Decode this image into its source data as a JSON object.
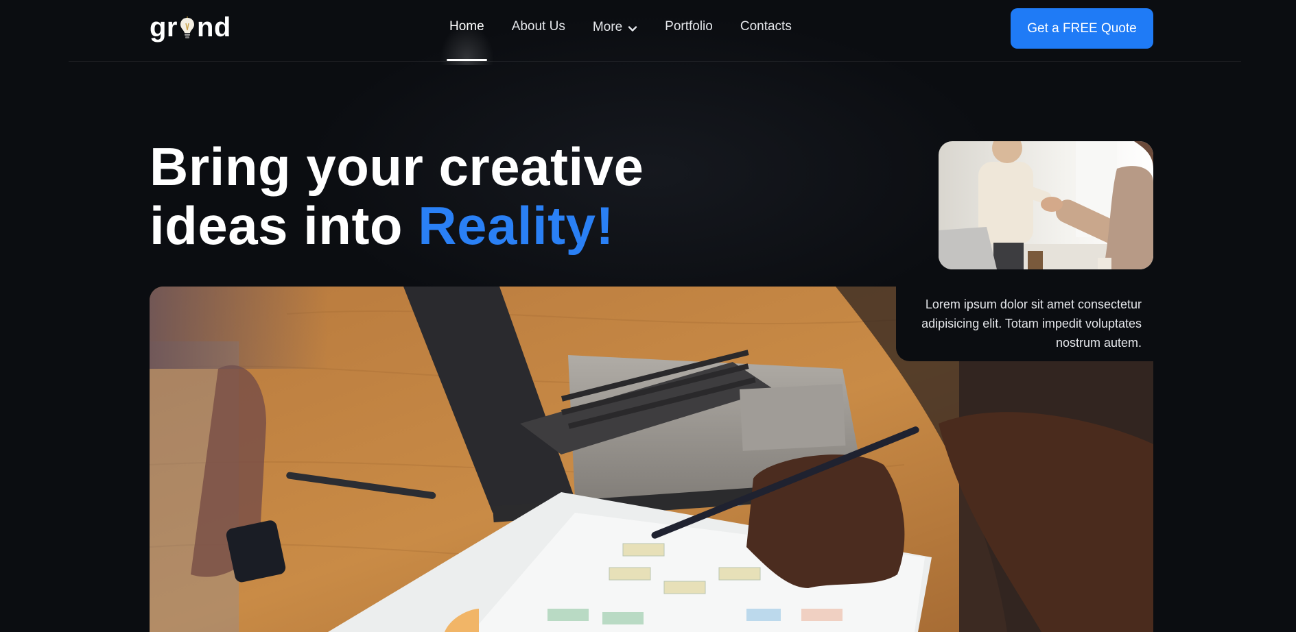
{
  "nav": {
    "logo": {
      "before": "gr",
      "after": "nd"
    },
    "items": [
      {
        "label": "Home"
      },
      {
        "label": "About Us"
      },
      {
        "label": "More"
      },
      {
        "label": "Portfolio"
      },
      {
        "label": "Contacts"
      }
    ],
    "active_item": "Home",
    "cta_label": "Get a FREE Quote"
  },
  "hero": {
    "headline_line1": "Bring your creative",
    "headline_line2_plain": "ideas into ",
    "headline_accent": "Reality!",
    "description": "Lorem ipsum dolor sit amet consectetur adipisicing elit. Totam impedit voluptates nostrum autem."
  },
  "colors": {
    "background": "#0b0d11",
    "accent": "#2a80f5",
    "cta": "#1f7bf6"
  },
  "icons": {
    "logo_glyph": "lightbulb-icon",
    "more_dropdown": "chevron-down-icon"
  }
}
